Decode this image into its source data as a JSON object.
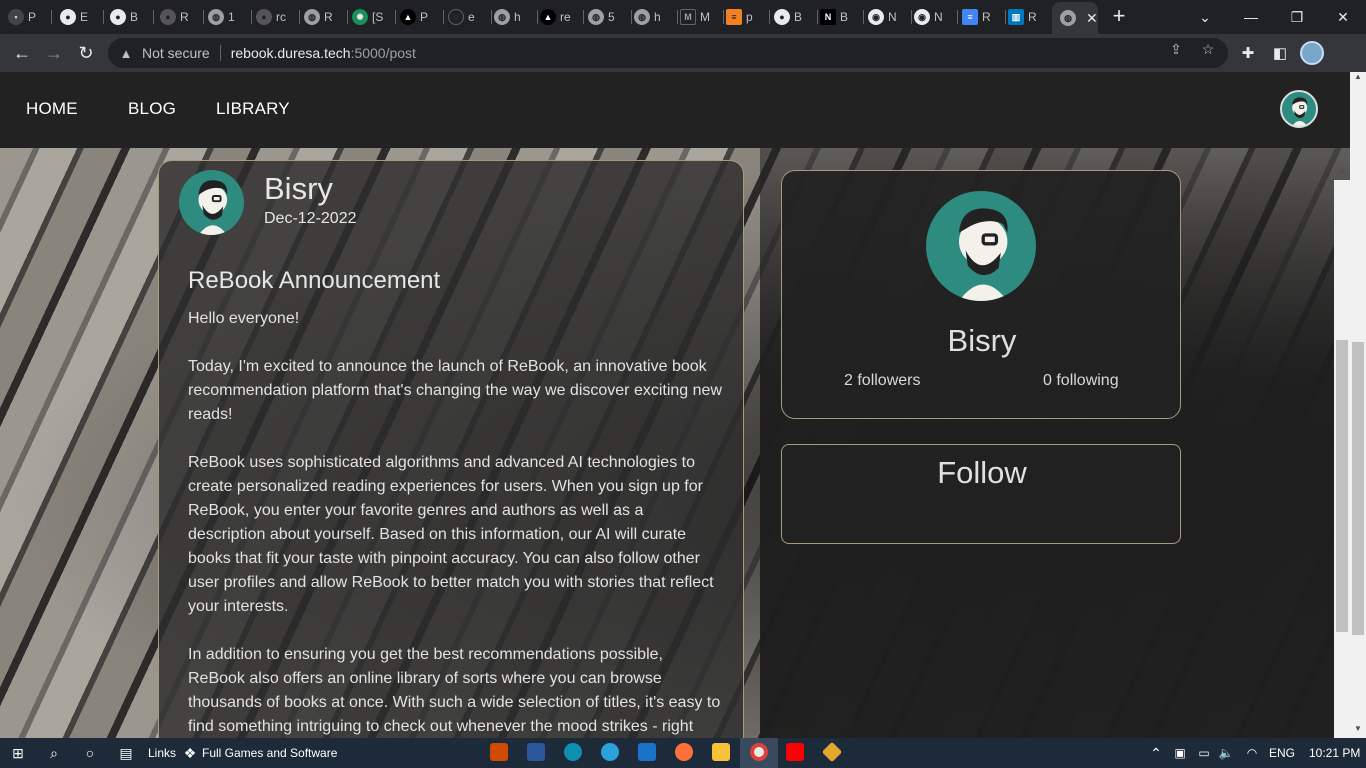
{
  "browser": {
    "tabs": [
      {
        "label": "P",
        "icon": "page-icon"
      },
      {
        "label": "E",
        "icon": "github-icon"
      },
      {
        "label": "B",
        "icon": "github-icon"
      },
      {
        "label": "R",
        "icon": "github-icon"
      },
      {
        "label": "1",
        "icon": "globe-icon"
      },
      {
        "label": "rc",
        "icon": "github-icon"
      },
      {
        "label": "R",
        "icon": "globe-icon"
      },
      {
        "label": "[S",
        "icon": "gear-icon"
      },
      {
        "label": "P",
        "icon": "triangle-icon"
      },
      {
        "label": "e",
        "icon": "loading-icon"
      },
      {
        "label": "h",
        "icon": "globe-icon"
      },
      {
        "label": "re",
        "icon": "triangle-icon"
      },
      {
        "label": "5",
        "icon": "globe-icon"
      },
      {
        "label": "h",
        "icon": "globe-icon"
      },
      {
        "label": "M",
        "icon": "markdown-icon"
      },
      {
        "label": "p",
        "icon": "stackoverflow-icon"
      },
      {
        "label": "B",
        "icon": "github-icon"
      },
      {
        "label": "B",
        "icon": "notion-icon"
      },
      {
        "label": "N",
        "icon": "chrome-icon"
      },
      {
        "label": "N",
        "icon": "chrome-icon"
      },
      {
        "label": "R",
        "icon": "docs-icon"
      },
      {
        "label": "R",
        "icon": "trello-icon"
      }
    ],
    "active_tab_close": "✕",
    "new_tab": "+",
    "address": {
      "security_label": "Not secure",
      "host": "rebook.duresa.tech",
      "path": ":5000/post"
    }
  },
  "site": {
    "nav": {
      "home": "HOME",
      "blog": "BLOG",
      "library": "LIBRARY"
    }
  },
  "post": {
    "author": "Bisry",
    "date": "Dec-12-2022",
    "title": "ReBook Announcement",
    "paragraphs": [
      "Hello everyone!",
      "Today, I'm excited to announce the launch of ReBook, an innovative book recommendation platform that's changing the way we discover exciting new reads!",
      "ReBook uses sophisticated algorithms and advanced AI technologies to create personalized reading experiences for users. When you sign up for ReBook, you enter your favorite genres and authors as well as a description about yourself. Based on this information, our AI will curate books that fit your taste with pinpoint accuracy. You can also follow other user profiles and allow ReBook to better match you with stories that reflect your interests.",
      "In addition to ensuring you get the best recommendations possible, ReBook also offers an online library of sorts where you can browse thousands of books at once. With such a wide selection of titles, it's easy to find something intriguing to check out whenever the mood strikes - right"
    ]
  },
  "profile": {
    "name": "Bisry",
    "followers": "2 followers",
    "following": "0 following",
    "follow_label": "Follow"
  },
  "taskbar": {
    "links_label": "Links",
    "bookmark_label": "Full Games and Software",
    "lang": "ENG",
    "time": "10:21 PM"
  },
  "colors": {
    "accent_teal": "#2e8b80",
    "card_border": "#a89a7c",
    "navbar_bg": "#222222"
  }
}
